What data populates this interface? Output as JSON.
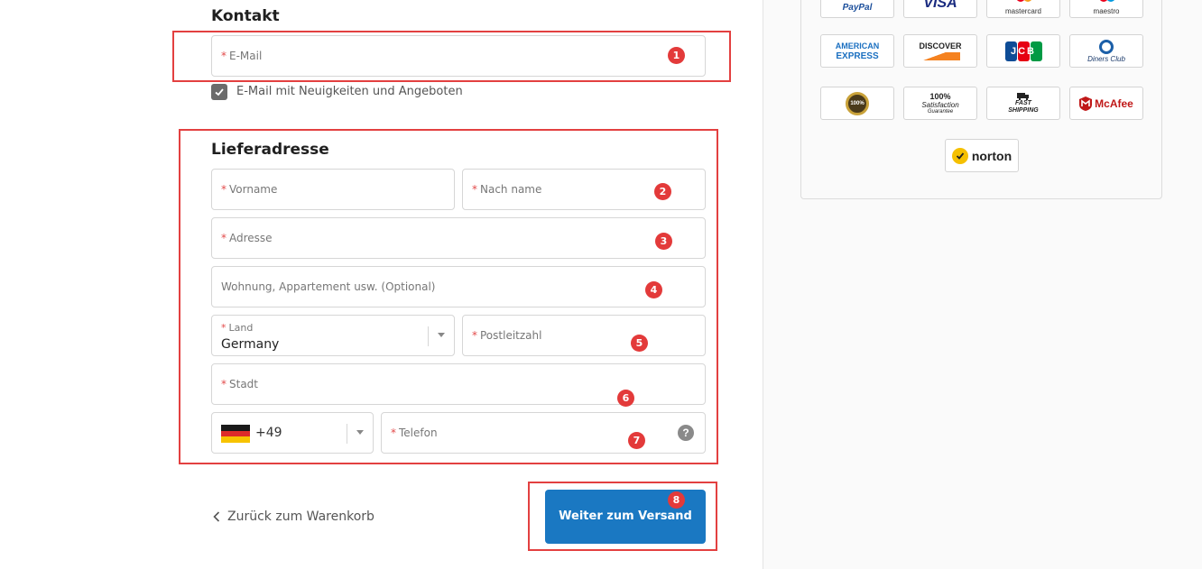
{
  "contact": {
    "title": "Kontakt",
    "email_placeholder": "E-Mail",
    "newsletter_label": "E-Mail mit Neuigkeiten und Angeboten",
    "newsletter_checked": true
  },
  "shipping": {
    "title": "Lieferadresse",
    "first_name_placeholder": "Vorname",
    "last_name_placeholder": "Nach name",
    "address_placeholder": "Adresse",
    "apartment_placeholder": "Wohnung, Appartement usw. (Optional)",
    "country_label": "Land",
    "country_value": "Germany",
    "postal_placeholder": "Postleitzahl",
    "city_placeholder": "Stadt",
    "phone_code": "+49",
    "phone_placeholder": "Telefon",
    "help_icon": "?"
  },
  "required_mark": "*",
  "badges": [
    "1",
    "2",
    "3",
    "4",
    "5",
    "6",
    "7",
    "8"
  ],
  "footer": {
    "back_label": "Zurück zum Warenkorb",
    "submit_label": "Weiter zum Versand"
  },
  "payment_logos": {
    "paypal": "PayPal",
    "visa": "VISA",
    "mastercard": "mastercard",
    "maestro": "maestro",
    "amex_line1": "AMERICAN",
    "amex_line2": "EXPRESS",
    "discover": "DISCOVER",
    "jcb": "JCB",
    "diners": "Diners Club",
    "guarantee_badge": "100%",
    "satisfaction_line1": "100%",
    "satisfaction_line2": "Satisfaction",
    "satisfaction_line3": "Guarantee",
    "shipping_line1": "FAST",
    "shipping_line2": "SHIPPING",
    "mcafee": "McAfee",
    "norton": "norton"
  },
  "colors": {
    "accent": "#1a78c2",
    "annotation_red": "#e33a3a",
    "required_red": "#e34b4b"
  }
}
